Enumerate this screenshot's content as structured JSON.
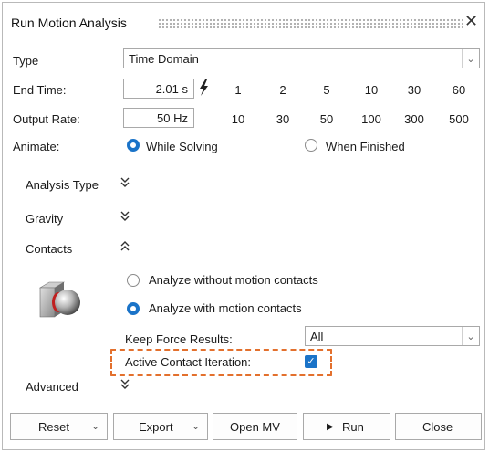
{
  "window": {
    "title": "Run Motion Analysis",
    "close_icon": "close-icon"
  },
  "type": {
    "label": "Type",
    "value": "Time Domain"
  },
  "end_time": {
    "label": "End Time:",
    "value": "2.01 s",
    "icon": "lightning-icon",
    "presets": [
      "1",
      "2",
      "5",
      "10",
      "30",
      "60"
    ]
  },
  "output_rate": {
    "label": "Output Rate:",
    "value": "50 Hz",
    "presets": [
      "10",
      "30",
      "50",
      "100",
      "300",
      "500"
    ]
  },
  "animate": {
    "label": "Animate:",
    "options": [
      "While Solving",
      "When Finished"
    ],
    "selected": "While Solving"
  },
  "sections": {
    "analysis_type": {
      "label": "Analysis Type",
      "state": "collapsed"
    },
    "gravity": {
      "label": "Gravity",
      "state": "collapsed"
    },
    "contacts": {
      "label": "Contacts",
      "state": "expanded"
    },
    "advanced": {
      "label": "Advanced",
      "state": "collapsed"
    }
  },
  "contacts": {
    "icon": "motion-contact-icon",
    "options": [
      "Analyze without motion contacts",
      "Analyze with motion contacts"
    ],
    "selected": "Analyze with motion contacts",
    "keep_force_label": "Keep Force Results:",
    "keep_force_value": "All",
    "active_iteration_label": "Active Contact Iteration:",
    "active_iteration_checked": true,
    "highlight_color": "#e3702d"
  },
  "buttons": {
    "reset": "Reset",
    "export": "Export",
    "open_mv": "Open MV",
    "run": "Run",
    "close": "Close"
  },
  "colors": {
    "accent": "#1a73c8",
    "border": "#a9a9a9"
  }
}
